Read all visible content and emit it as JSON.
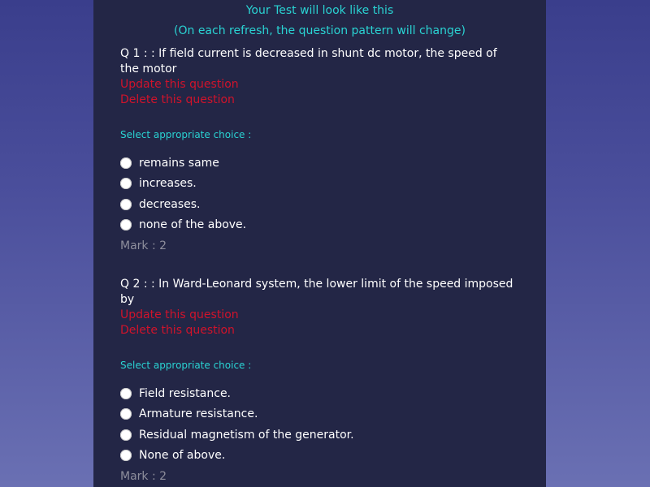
{
  "header": {
    "title": "Your Test will look like this",
    "subtitle": "(On each refresh, the question pattern will change)"
  },
  "questions": [
    {
      "text": "Q 1 : : If field current is decreased in shunt dc motor, the speed of the motor",
      "update_label": "Update this question",
      "delete_label": "Delete this question",
      "choice_heading": "Select appropriate choice :",
      "options": [
        "remains same",
        "increases.",
        "decreases.",
        "none of the above."
      ],
      "mark": "Mark : 2"
    },
    {
      "text": "Q 2 : : In Ward-Leonard system, the lower limit of the speed imposed by",
      "update_label": "Update this question",
      "delete_label": "Delete this question",
      "choice_heading": "Select appropriate choice :",
      "options": [
        "Field resistance.",
        "Armature resistance.",
        "Residual magnetism of the generator.",
        "None of above."
      ],
      "mark": "Mark : 2"
    }
  ],
  "colors": {
    "accent": "#2ad3d3",
    "danger": "#d0132b",
    "panel": "#232646",
    "muted": "#8e8e9c"
  }
}
